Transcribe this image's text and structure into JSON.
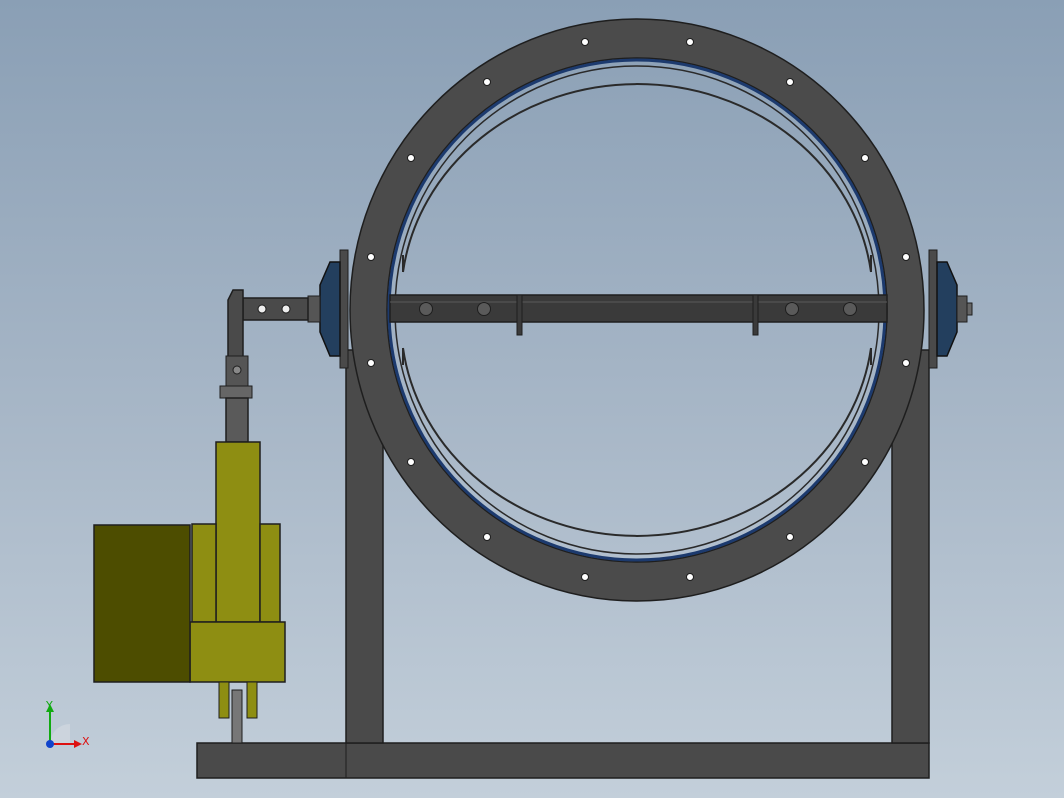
{
  "view": {
    "background_top": "#8a9fb5",
    "background_bottom": "#c3cfda"
  },
  "materials": {
    "steel_dark": "#4a4a4a",
    "steel_edge": "#1e1e1e",
    "seal_blue": "#1c3a6e",
    "bearing_blue": "#233f5e",
    "actuator_olive": "#8e8e12",
    "motor_olive": "#4d4d00",
    "shaft_grey": "#3c3c3c"
  },
  "triad": {
    "x_label": "X",
    "y_label": "Y",
    "x_color": "#d11",
    "y_color": "#1a1",
    "z_color": "#1144cc"
  }
}
